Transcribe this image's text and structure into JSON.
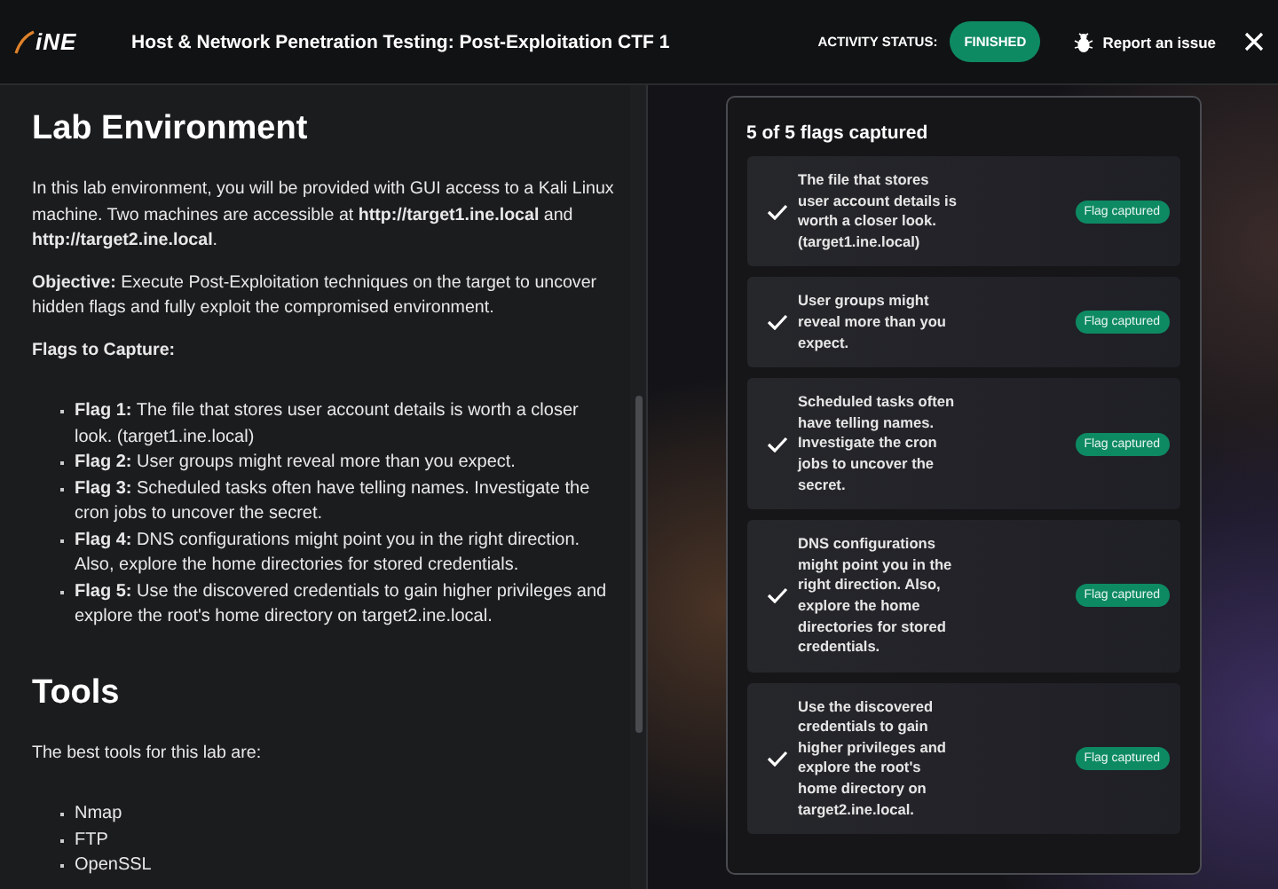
{
  "header": {
    "logo": "iNE",
    "title": "Host & Network Penetration Testing: Post-Exploitation CTF 1",
    "activity_status_label": "ACTIVITY STATUS:",
    "activity_status": "FINISHED",
    "report_button": "Report an issue"
  },
  "instructions": [
    {
      "kind": "heading",
      "text": "Lab Environment"
    },
    {
      "kind": "paragraph",
      "text": "In this lab environment, you will be provided with GUI access to a Kali Linux machine. Two machines are accessible at **http://target1.ine.local** and **http://target2.ine.local**."
    },
    {
      "kind": "paragraph",
      "text": "**Objective:** Execute Post-Exploitation techniques on the target to uncover hidden flags and fully exploit the compromised environment."
    },
    {
      "kind": "paragraph",
      "text": "**Flags to Capture:**"
    },
    {
      "kind": "list",
      "items": [
        "**Flag 1:** The file that stores user account details is worth a closer look. (target1.ine.local)",
        "**Flag 2:** User groups might reveal more than you expect.",
        "**Flag 3:** Scheduled tasks often have telling names. Investigate the cron jobs to uncover the secret.",
        "**Flag 4:** DNS configurations might point you in the right direction. Also, explore the home directories for stored credentials.",
        "**Flag 5:** Use the discovered credentials to gain higher privileges and explore the root's home directory on target2.ine.local."
      ]
    },
    {
      "kind": "heading",
      "text": "Tools"
    },
    {
      "kind": "paragraph",
      "text": "The best tools for this lab are:"
    },
    {
      "kind": "list",
      "items": [
        "Nmap",
        "FTP",
        "OpenSSL"
      ]
    }
  ],
  "flags_panel": {
    "title": "5 of 5 flags captured",
    "flags": [
      {
        "text": "The file that stores user account details is worth a closer look. (target1.ine.local)",
        "captured": true,
        "badge": "Flag captured"
      },
      {
        "text": "User groups might reveal more than you expect.",
        "captured": true,
        "badge": "Flag captured"
      },
      {
        "text": "Scheduled tasks often have telling names. Investigate the cron jobs to uncover the secret.",
        "captured": true,
        "badge": "Flag captured"
      },
      {
        "text": "DNS configurations might point you in the right direction. Also, explore the home directories for stored credentials.",
        "captured": true,
        "badge": "Flag captured"
      },
      {
        "text": "Use the discovered credentials to gain higher privileges and explore the root's home directory on target2.ine.local.",
        "captured": true,
        "badge": "Flag captured"
      }
    ]
  }
}
